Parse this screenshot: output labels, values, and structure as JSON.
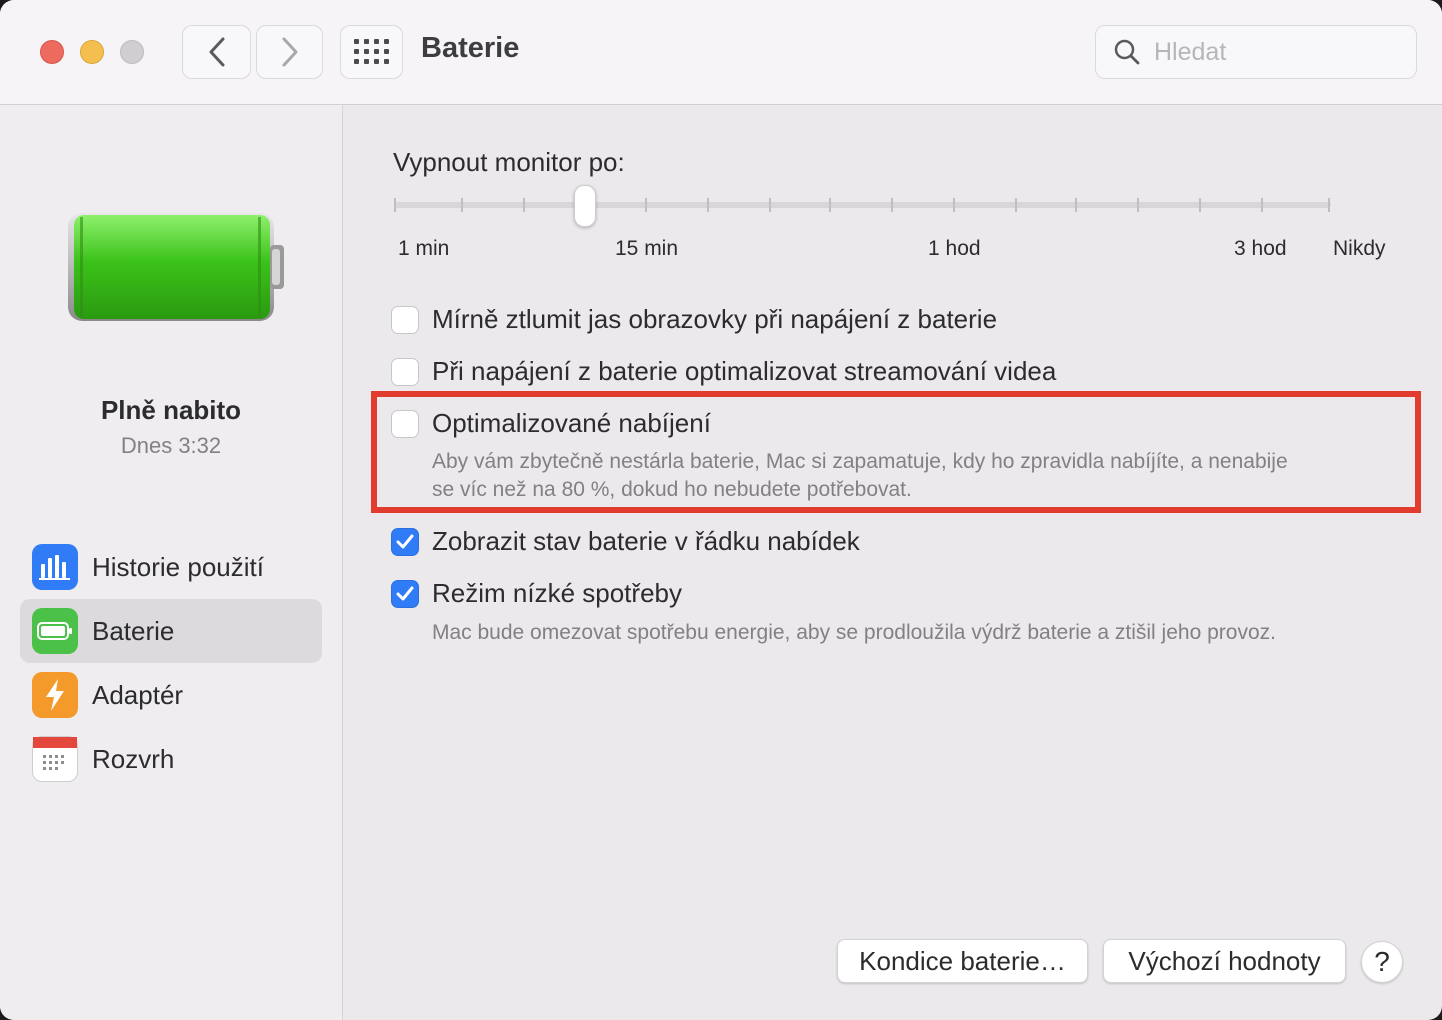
{
  "window": {
    "title": "Baterie"
  },
  "search": {
    "placeholder": "Hledat"
  },
  "sidebar": {
    "status_title": "Plně nabito",
    "status_time": "Dnes 3:32",
    "items": [
      {
        "label": "Historie použití",
        "icon": "bar-chart-icon",
        "selected": false
      },
      {
        "label": "Baterie",
        "icon": "battery-icon",
        "selected": true
      },
      {
        "label": "Adaptér",
        "icon": "lightning-icon",
        "selected": false
      },
      {
        "label": "Rozvrh",
        "icon": "calendar-icon",
        "selected": false
      }
    ]
  },
  "display_off": {
    "label": "Vypnout monitor po:",
    "tick_labels": [
      "1 min",
      "15 min",
      "1 hod",
      "3 hod",
      "Nikdy"
    ],
    "value": "4 min"
  },
  "options": [
    {
      "label": "Mírně ztlumit jas obrazovky při napájení z baterie",
      "checked": false
    },
    {
      "label": "Při napájení z baterie optimalizovat streamování videa",
      "checked": false
    },
    {
      "label": "Optimalizované nabíjení",
      "checked": false,
      "description_line1": "Aby vám zbytečně nestárla baterie, Mac si zapamatuje, kdy ho zpravidla nabíjíte, a nenabije",
      "description_line2": "se víc než na 80 %, dokud ho nebudete potřebovat."
    },
    {
      "label": "Zobrazit stav baterie v řádku nabídek",
      "checked": true
    },
    {
      "label": "Režim nízké spotřeby",
      "checked": true,
      "description": "Mac bude omezovat spotřebu energie, aby se prodloužila výdrž baterie a ztišil jeho provoz."
    }
  ],
  "buttons": {
    "battery_health": "Kondice baterie…",
    "defaults": "Výchozí hodnoty",
    "help": "?"
  },
  "colors": {
    "accent": "#2f7cf6",
    "highlight_border": "#e13c2e",
    "battery_green": "#3bc21a"
  }
}
